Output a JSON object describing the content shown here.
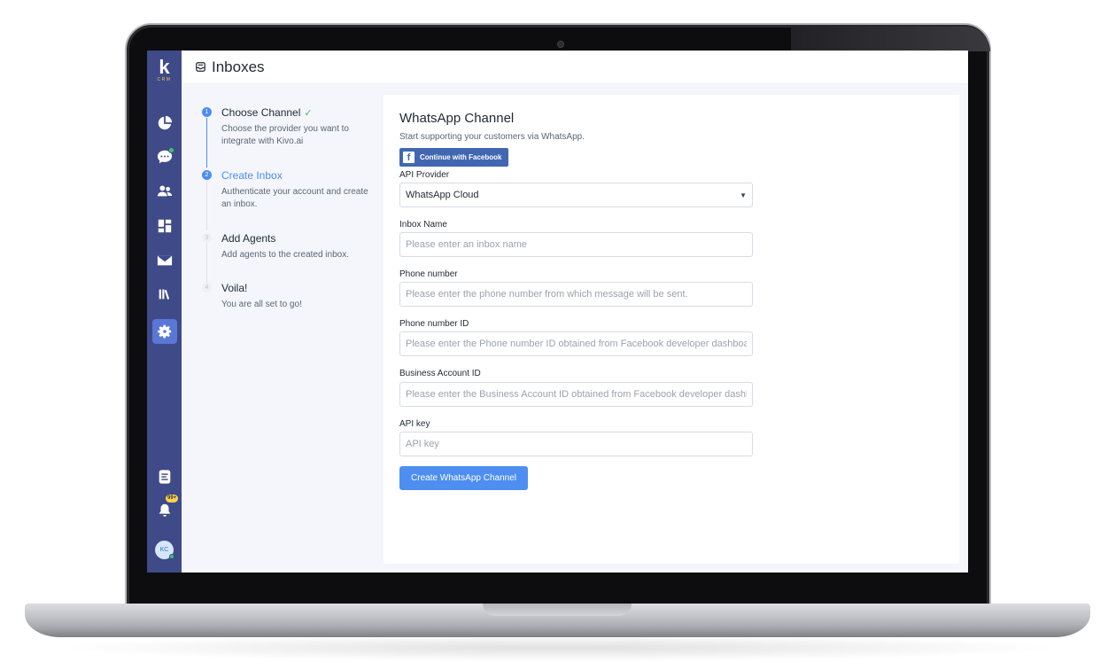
{
  "app": {
    "logo_letter": "k",
    "logo_sub": "CRM",
    "page_title": "Inboxes",
    "notification_badge": "99+",
    "avatar_initials": "KC",
    "accent_color": "#4d8ef0",
    "sidebar_color": "#3f4a88"
  },
  "sidebar": {
    "icons": [
      "dashboard-icon",
      "conversations-icon",
      "contacts-icon",
      "reports-icon",
      "campaigns-icon",
      "library-icon",
      "settings-icon"
    ],
    "bottom_icons": [
      "notes-icon",
      "bell-icon",
      "avatar"
    ]
  },
  "steps": [
    {
      "number": "1",
      "title": "Choose Channel",
      "check": "✓",
      "desc": "Choose the provider you want to integrate with Kivo.ai",
      "state": "done"
    },
    {
      "number": "2",
      "title": "Create Inbox",
      "desc": "Authenticate your account and create an inbox.",
      "state": "active"
    },
    {
      "number": "3",
      "title": "Add Agents",
      "desc": "Add agents to the created inbox.",
      "state": "pending"
    },
    {
      "number": "4",
      "title": "Voila!",
      "desc": "You are all set to go!",
      "state": "pending"
    }
  ],
  "form": {
    "title": "WhatsApp Channel",
    "subtitle": "Start supporting your customers via WhatsApp.",
    "facebook_button": "Continue with Facebook",
    "api_provider": {
      "label": "API Provider",
      "value": "WhatsApp Cloud"
    },
    "inbox_name": {
      "label": "Inbox Name",
      "placeholder": "Please enter an inbox name"
    },
    "phone_number": {
      "label": "Phone number",
      "placeholder": "Please enter the phone number from which message will be sent."
    },
    "phone_number_id": {
      "label": "Phone number ID",
      "placeholder": "Please enter the Phone number ID obtained from Facebook developer dashboard."
    },
    "business_account_id": {
      "label": "Business Account ID",
      "placeholder": "Please enter the Business Account ID obtained from Facebook developer dashboard."
    },
    "api_key": {
      "label": "API key",
      "placeholder": "API key"
    },
    "submit": "Create WhatsApp Channel"
  }
}
